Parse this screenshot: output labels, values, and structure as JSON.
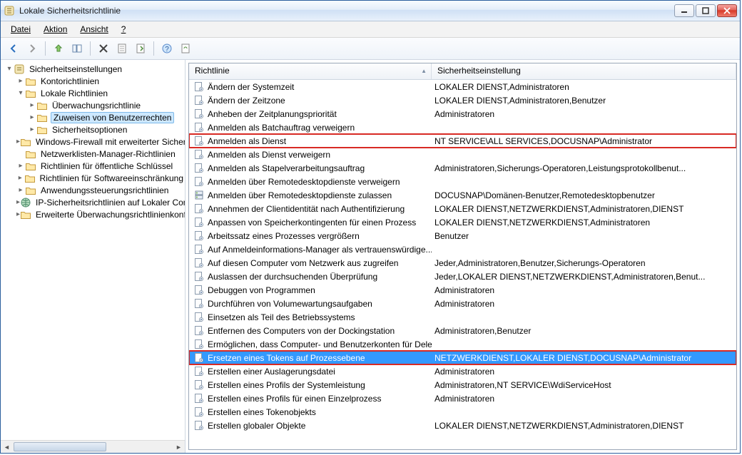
{
  "window": {
    "title": "Lokale Sicherheitsrichtlinie"
  },
  "menubar": {
    "file": "Datei",
    "action": "Aktion",
    "view": "Ansicht",
    "help": "?"
  },
  "tree": {
    "root": "Sicherheitseinstellungen",
    "items": [
      {
        "label": "Kontorichtlinien",
        "depth": 1,
        "expandable": true,
        "expanded": false
      },
      {
        "label": "Lokale Richtlinien",
        "depth": 1,
        "expandable": true,
        "expanded": true
      },
      {
        "label": "Überwachungsrichtlinie",
        "depth": 2,
        "expandable": true,
        "expanded": false
      },
      {
        "label": "Zuweisen von Benutzerrechten",
        "depth": 2,
        "expandable": true,
        "expanded": false,
        "selected": true
      },
      {
        "label": "Sicherheitsoptionen",
        "depth": 2,
        "expandable": true,
        "expanded": false
      },
      {
        "label": "Windows-Firewall mit erweiterter Sicherheit",
        "depth": 1,
        "expandable": true,
        "expanded": false
      },
      {
        "label": "Netzwerklisten-Manager-Richtlinien",
        "depth": 1,
        "expandable": false,
        "expanded": false
      },
      {
        "label": "Richtlinien für öffentliche Schlüssel",
        "depth": 1,
        "expandable": true,
        "expanded": false
      },
      {
        "label": "Richtlinien für Softwareeinschränkung",
        "depth": 1,
        "expandable": true,
        "expanded": false
      },
      {
        "label": "Anwendungssteuerungsrichtlinien",
        "depth": 1,
        "expandable": true,
        "expanded": false
      },
      {
        "label": "IP-Sicherheitsrichtlinien auf Lokaler Computer",
        "depth": 1,
        "expandable": true,
        "expanded": false,
        "icon": "globe"
      },
      {
        "label": "Erweiterte Überwachungsrichtlinienkonfiguration",
        "depth": 1,
        "expandable": true,
        "expanded": false
      }
    ]
  },
  "list": {
    "header_policy": "Richtlinie",
    "header_setting": "Sicherheitseinstellung",
    "rows": [
      {
        "name": "Ändern der Systemzeit",
        "value": "LOKALER DIENST,Administratoren"
      },
      {
        "name": "Ändern der Zeitzone",
        "value": "LOKALER DIENST,Administratoren,Benutzer"
      },
      {
        "name": "Anheben der Zeitplanungspriorität",
        "value": "Administratoren"
      },
      {
        "name": "Anmelden als Batchauftrag verweigern",
        "value": ""
      },
      {
        "name": "Anmelden als Dienst",
        "value": "NT SERVICE\\ALL SERVICES,DOCUSNAP\\Administrator",
        "highlight": true
      },
      {
        "name": "Anmelden als Dienst verweigern",
        "value": ""
      },
      {
        "name": "Anmelden als Stapelverarbeitungsauftrag",
        "value": "Administratoren,Sicherungs-Operatoren,Leistungsprotokollbenut..."
      },
      {
        "name": "Anmelden über Remotedesktopdienste verweigern",
        "value": ""
      },
      {
        "name": "Anmelden über Remotedesktopdienste zulassen",
        "value": "DOCUSNAP\\Domänen-Benutzer,Remotedesktopbenutzer",
        "icon": "server"
      },
      {
        "name": "Annehmen der Clientidentität nach Authentifizierung",
        "value": "LOKALER DIENST,NETZWERKDIENST,Administratoren,DIENST"
      },
      {
        "name": "Anpassen von Speicherkontingenten für einen Prozess",
        "value": "LOKALER DIENST,NETZWERKDIENST,Administratoren"
      },
      {
        "name": "Arbeitssatz eines Prozesses vergrößern",
        "value": "Benutzer"
      },
      {
        "name": "Auf Anmeldeinformations-Manager als vertrauenswürdige...",
        "value": ""
      },
      {
        "name": "Auf diesen Computer vom Netzwerk aus zugreifen",
        "value": "Jeder,Administratoren,Benutzer,Sicherungs-Operatoren"
      },
      {
        "name": "Auslassen der durchsuchenden Überprüfung",
        "value": "Jeder,LOKALER DIENST,NETZWERKDIENST,Administratoren,Benut..."
      },
      {
        "name": "Debuggen von Programmen",
        "value": "Administratoren"
      },
      {
        "name": "Durchführen von Volumewartungsaufgaben",
        "value": "Administratoren"
      },
      {
        "name": "Einsetzen als Teil des Betriebssystems",
        "value": ""
      },
      {
        "name": "Entfernen des Computers von der Dockingstation",
        "value": "Administratoren,Benutzer"
      },
      {
        "name": "Ermöglichen, dass Computer- und Benutzerkonten für Dele...",
        "value": ""
      },
      {
        "name": "Ersetzen eines Tokens auf Prozessebene",
        "value": "NETZWERKDIENST,LOKALER DIENST,DOCUSNAP\\Administrator",
        "selected": true,
        "highlight": true
      },
      {
        "name": "Erstellen einer Auslagerungsdatei",
        "value": "Administratoren"
      },
      {
        "name": "Erstellen eines Profils der Systemleistung",
        "value": "Administratoren,NT SERVICE\\WdiServiceHost"
      },
      {
        "name": "Erstellen eines Profils für einen Einzelprozess",
        "value": "Administratoren"
      },
      {
        "name": "Erstellen eines Tokenobjekts",
        "value": ""
      },
      {
        "name": "Erstellen globaler Objekte",
        "value": "LOKALER DIENST,NETZWERKDIENST,Administratoren,DIENST"
      }
    ]
  }
}
